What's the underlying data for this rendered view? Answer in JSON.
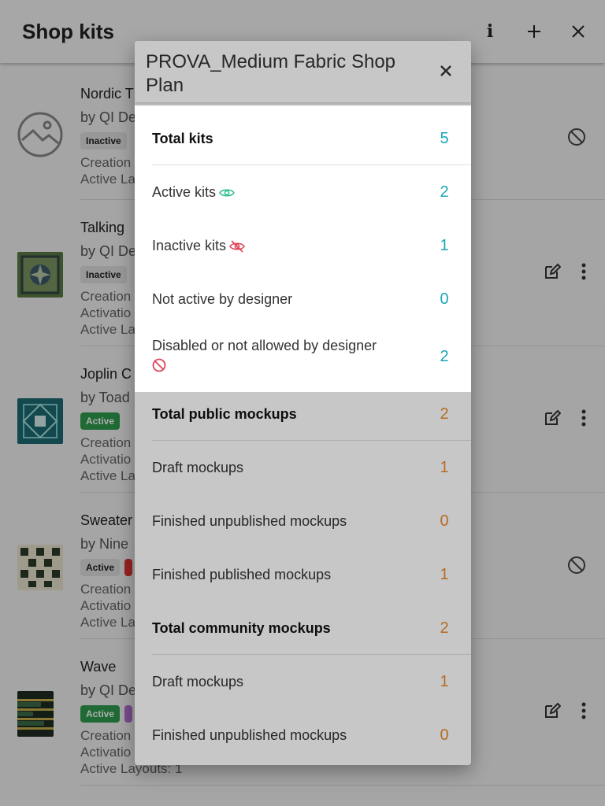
{
  "appbar": {
    "title": "Shop kits",
    "actions": [
      {
        "name": "info-icon",
        "glyph": "i"
      },
      {
        "name": "add-icon"
      },
      {
        "name": "close-icon"
      }
    ]
  },
  "kits": [
    {
      "name": "Nordic T",
      "by": "by QI De",
      "chips": [
        {
          "label": "Inactive",
          "kind": "inactive"
        }
      ],
      "meta": [
        "Creation",
        "Active La"
      ]
    },
    {
      "name": "Talking",
      "by": "by QI De",
      "chips": [
        {
          "label": "Inactive",
          "kind": "inactive"
        }
      ],
      "meta": [
        "Creation",
        "Activatio",
        "Active La"
      ]
    },
    {
      "name": "Joplin C",
      "by": "by Toad",
      "chips": [
        {
          "label": "Active",
          "kind": "active-green"
        }
      ],
      "meta": [
        "Creation",
        "Activatio",
        "Active La"
      ]
    },
    {
      "name": "Sweater",
      "by": "by Nine",
      "chips": [
        {
          "label": "Active",
          "kind": "active-grey"
        },
        {
          "label": "",
          "kind": "red"
        }
      ],
      "meta": [
        "Creation",
        "Activatio",
        "Active La"
      ]
    },
    {
      "name": "Wave",
      "by": "by QI De",
      "chips": [
        {
          "label": "Active",
          "kind": "active-green"
        },
        {
          "label": "",
          "kind": "violet"
        }
      ],
      "meta": [
        "Creation",
        "Activatio",
        "Active Layouts: 1"
      ]
    }
  ],
  "dialog": {
    "title": "PROVA_Medium Fabric Shop Plan",
    "stats": [
      {
        "label": "Total kits",
        "value": "5",
        "total": true,
        "color": "teal"
      },
      {
        "label": "Active kits",
        "value": "2",
        "icon": "eye-icon",
        "color": "teal"
      },
      {
        "label": "Inactive kits",
        "value": "1",
        "icon": "eye-off-icon",
        "color": "teal"
      },
      {
        "label": "Not active by designer",
        "value": "0",
        "color": "teal"
      },
      {
        "label": "Disabled or not allowed by designer",
        "value": "2",
        "icon": "block-icon",
        "color": "teal"
      },
      {
        "label": "Total public mockups",
        "value": "2",
        "total": true,
        "color": "orange"
      },
      {
        "label": "Draft mockups",
        "value": "1",
        "color": "orange"
      },
      {
        "label": "Finished unpublished mockups",
        "value": "0",
        "color": "orange"
      },
      {
        "label": "Finished published mockups",
        "value": "1",
        "color": "orange"
      },
      {
        "label": "Total community mockups",
        "value": "2",
        "total": true,
        "color": "orange"
      },
      {
        "label": "Draft mockups",
        "value": "1",
        "color": "orange"
      },
      {
        "label": "Finished unpublished mockups",
        "value": "0",
        "color": "orange"
      }
    ]
  },
  "colors": {
    "teal": "#19a5b8",
    "orange": "#e8892f",
    "eye_green": "#2fbf8a",
    "eye_red": "#e0455a"
  }
}
